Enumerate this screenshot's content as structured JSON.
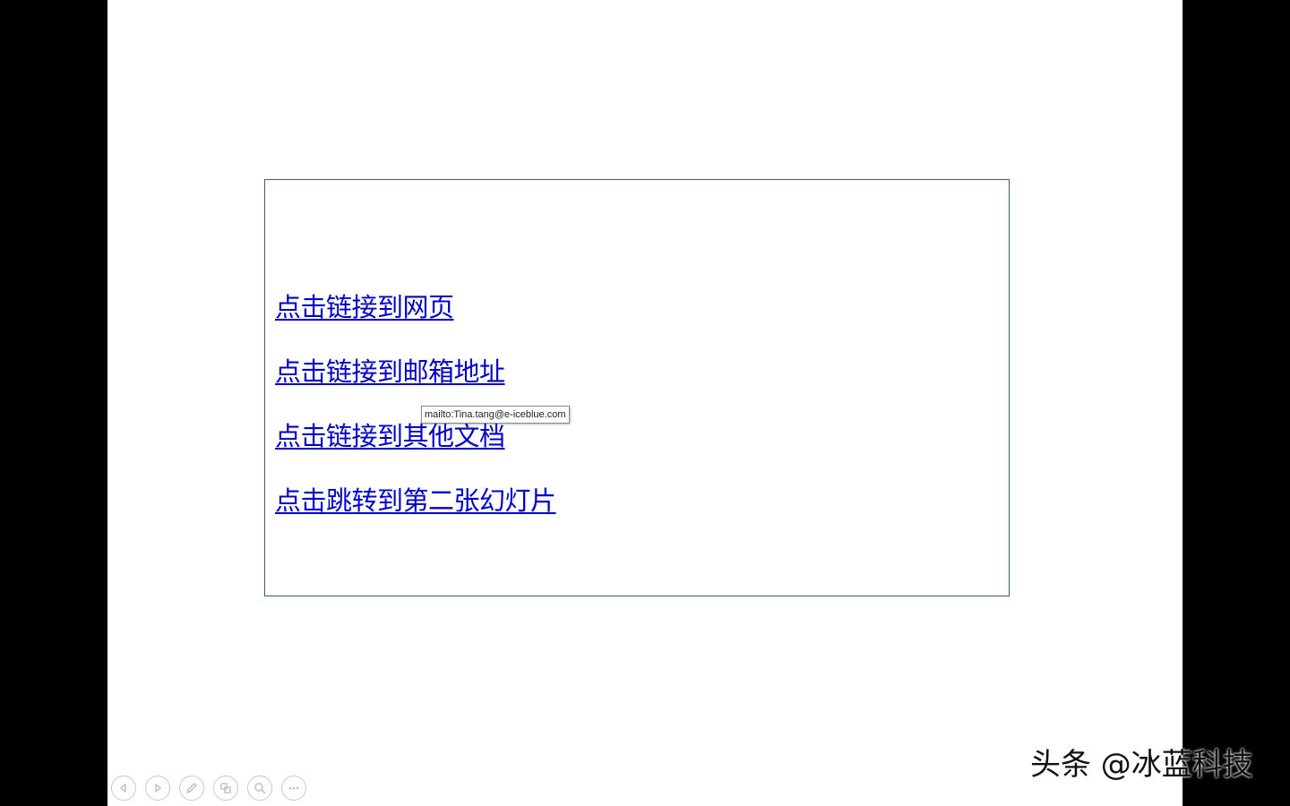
{
  "slide": {
    "links": [
      {
        "label": "点击链接到网页"
      },
      {
        "label": "点击链接到邮箱地址"
      },
      {
        "label": "点击链接到其他文档"
      },
      {
        "label": "点击跳转到第二张幻灯片"
      }
    ],
    "tooltip": "mailto:Tina.tang@e-iceblue.com"
  },
  "toolbar": {
    "buttons": [
      {
        "icon": "previous-icon"
      },
      {
        "icon": "next-icon"
      },
      {
        "icon": "pen-icon"
      },
      {
        "icon": "slides-icon"
      },
      {
        "icon": "zoom-icon"
      },
      {
        "icon": "more-icon"
      }
    ]
  },
  "watermark": "头条 @冰蓝科技",
  "colors": {
    "link": "#0000cc",
    "border": "#3b5a78",
    "background": "#000000",
    "slide": "#ffffff"
  }
}
